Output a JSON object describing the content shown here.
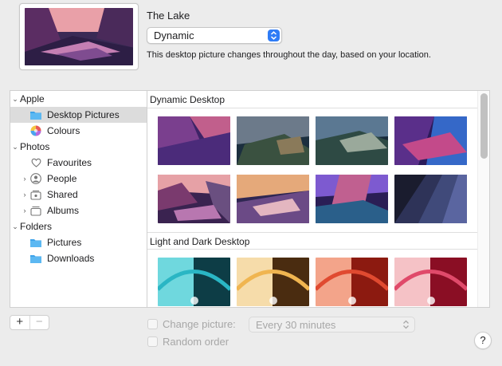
{
  "header": {
    "title": "The Lake",
    "mode_value": "Dynamic",
    "description": "This desktop picture changes throughout the day, based on your location."
  },
  "sidebar": {
    "apple": {
      "label": "Apple",
      "items": [
        {
          "label": "Desktop Pictures",
          "icon": "folder-icon"
        },
        {
          "label": "Colours",
          "icon": "color-wheel-icon"
        }
      ]
    },
    "photos": {
      "label": "Photos",
      "items": [
        {
          "label": "Favourites",
          "icon": "heart-icon"
        },
        {
          "label": "People",
          "icon": "person-icon"
        },
        {
          "label": "Shared",
          "icon": "shared-album-icon"
        },
        {
          "label": "Albums",
          "icon": "album-icon"
        }
      ]
    },
    "folders": {
      "label": "Folders",
      "items": [
        {
          "label": "Pictures",
          "icon": "folder-icon"
        },
        {
          "label": "Downloads",
          "icon": "folder-icon"
        }
      ]
    }
  },
  "gallery": {
    "section1": "Dynamic Desktop",
    "section2": "Light and Dark Desktop"
  },
  "bottom": {
    "add_label": "+",
    "remove_label": "−",
    "change_picture_label": "Change picture:",
    "interval_value": "Every 30 minutes",
    "random_order_label": "Random order",
    "help_label": "?"
  },
  "colors": {
    "accent": "#2f7cf6",
    "folder": "#3ea3ea"
  }
}
